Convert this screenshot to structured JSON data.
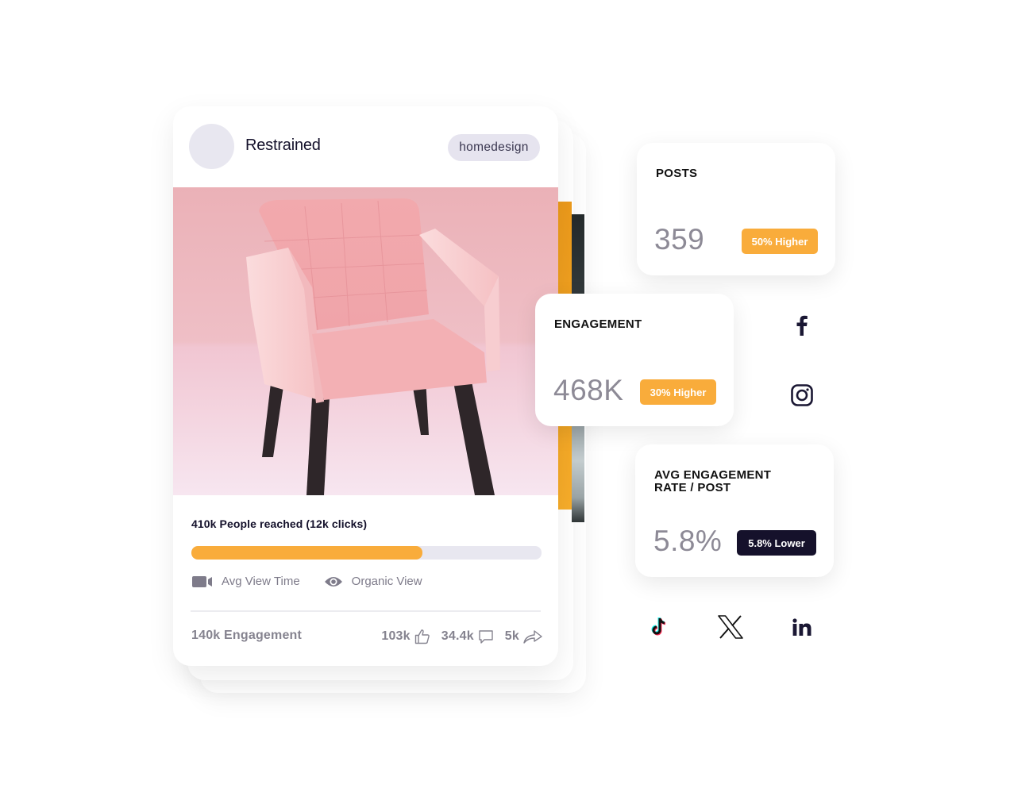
{
  "post": {
    "author": "Restrained",
    "tag": "homedesign",
    "image_alt": "pink armchair",
    "reach_text": "410k People reached (12k clicks)",
    "reach_progress_percent": 66,
    "metrics": [
      {
        "icon": "video-camera-icon",
        "label": "Avg View Time"
      },
      {
        "icon": "eye-icon",
        "label": "Organic View"
      }
    ],
    "engagement_total": "140k Engagement",
    "likes": "103k",
    "comments": "34.4k",
    "shares": "5k"
  },
  "kpis": {
    "posts": {
      "title": "POSTS",
      "value": "359",
      "badge": "50% Higher"
    },
    "engagement": {
      "title": "ENGAGEMENT",
      "value": "468K",
      "badge": "30% Higher"
    },
    "avg_rate": {
      "title_line1": "AVG ENGAGEMENT",
      "title_line2": "RATE / POST",
      "value": "5.8%",
      "badge": "5.8% Lower"
    }
  },
  "social_networks": [
    "facebook",
    "instagram",
    "tiktok",
    "x",
    "linkedin"
  ],
  "colors": {
    "accent": "#f9ac3b",
    "dark": "#15112b",
    "muted_text": "#85838f",
    "track": "#e8e7f0"
  }
}
